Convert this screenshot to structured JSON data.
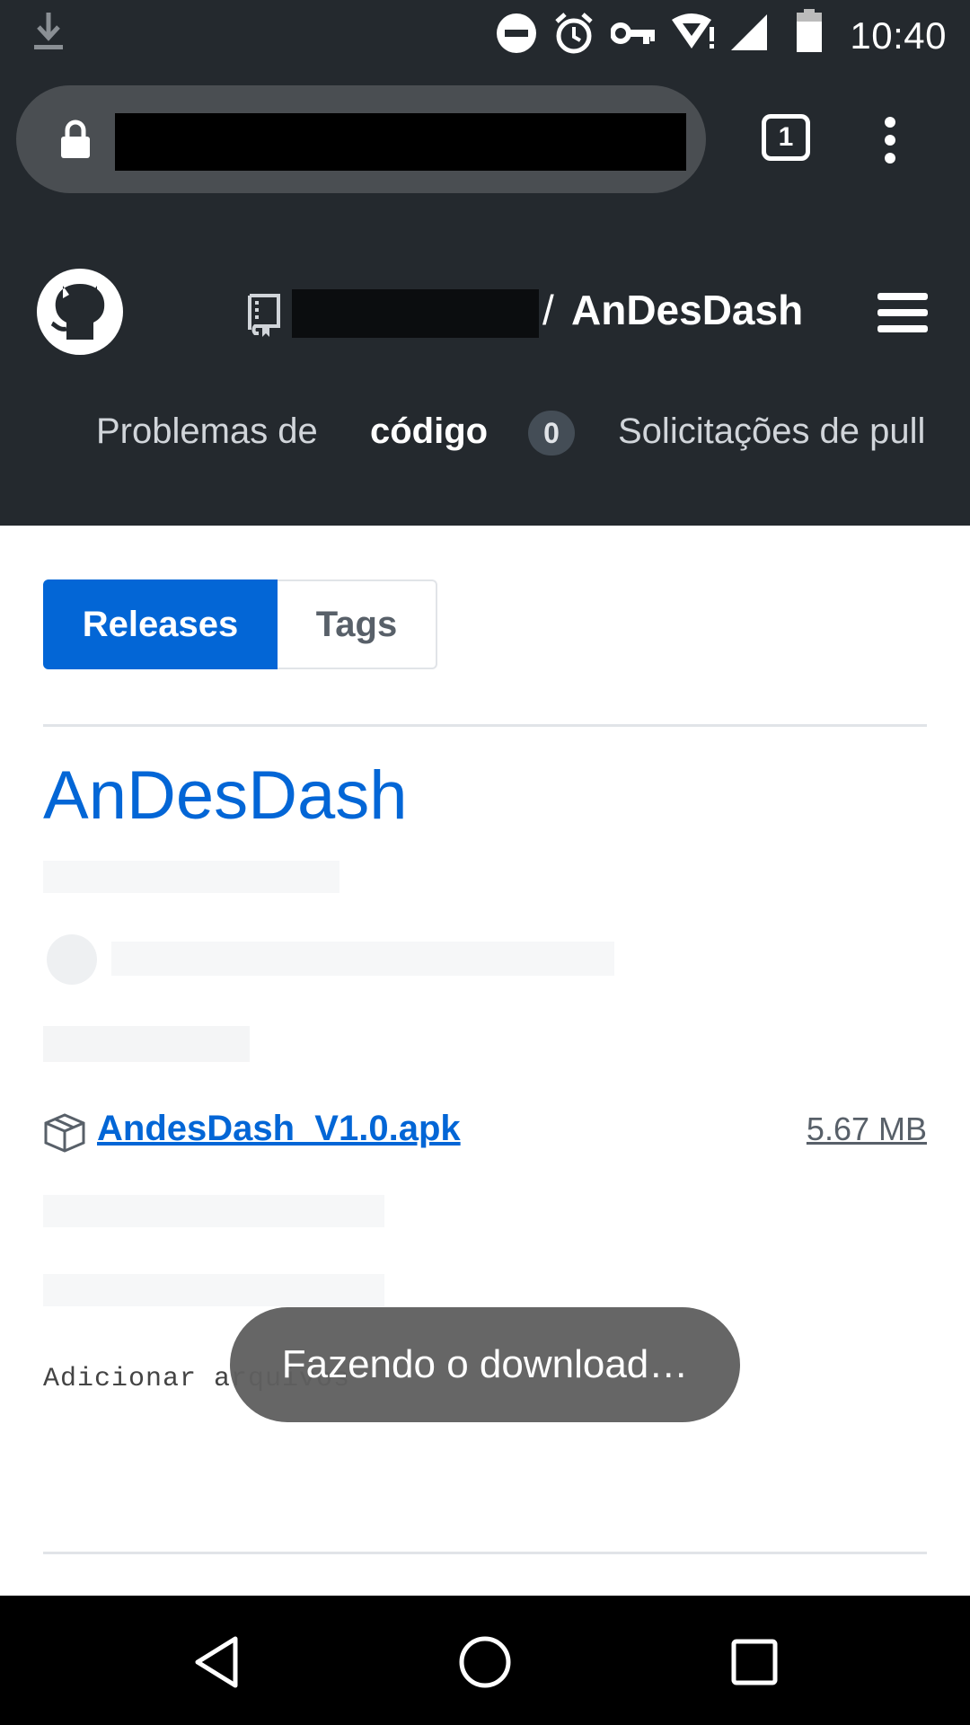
{
  "status_bar": {
    "time": "10:40",
    "icons": [
      "download-icon",
      "do-not-disturb-icon",
      "alarm-icon",
      "vpn-key-icon",
      "wifi-icon",
      "signal-icon",
      "battery-icon"
    ]
  },
  "browser": {
    "tab_count": "1",
    "url_redacted": true
  },
  "github": {
    "repo_name": "AnDesDash",
    "slash": "/",
    "subnav": {
      "tab1": "Problemas de",
      "tab2": "código",
      "issue_count": "0",
      "tab3": "Solicitações de pull"
    }
  },
  "releases": {
    "segment": {
      "releases_label": "Releases",
      "tags_label": "Tags"
    },
    "release_title": "AnDesDash",
    "asset": {
      "name": "AndesDash_V1.0.apk",
      "size": "5.67 MB"
    },
    "drop_text": "Adicionar arquivos"
  },
  "toast": {
    "text": "Fazendo o download…"
  },
  "colors": {
    "header_bg": "#24292e",
    "link_blue": "#0366d6",
    "toast_bg": "#606060"
  }
}
